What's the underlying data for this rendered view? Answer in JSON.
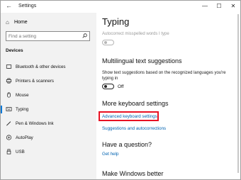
{
  "window": {
    "title": "Settings",
    "back_icon": "back-arrow-icon",
    "minimize_glyph": "—",
    "maximize_glyph": "☐",
    "close_glyph": "✕"
  },
  "sidebar": {
    "home_label": "Home",
    "search_placeholder": "Find a setting",
    "section_heading": "Devices",
    "items": [
      {
        "label": "Bluetooth & other devices",
        "icon": "bluetooth-icon"
      },
      {
        "label": "Printers & scanners",
        "icon": "printer-icon"
      },
      {
        "label": "Mouse",
        "icon": "mouse-icon"
      },
      {
        "label": "Typing",
        "icon": "keyboard-icon",
        "selected": true
      },
      {
        "label": "Pen & Windows Ink",
        "icon": "pen-icon"
      },
      {
        "label": "AutoPlay",
        "icon": "autoplay-icon"
      },
      {
        "label": "USB",
        "icon": "usb-icon"
      }
    ]
  },
  "main": {
    "title": "Typing",
    "autocorrect_label": "Autocorrect misspelled words I type",
    "multilingual": {
      "heading": "Multilingual text suggestions",
      "description": "Show text suggestions based on the recognized languages you're typing in",
      "toggle_state": "Off"
    },
    "more_keyboard": {
      "heading": "More keyboard settings",
      "advanced_link": "Advanced keyboard settings",
      "suggestions_link": "Suggestions and autocorrections"
    },
    "question": {
      "heading": "Have a question?",
      "help_link": "Get help"
    },
    "make_better": {
      "heading": "Make Windows better"
    }
  },
  "colors": {
    "accent": "#0078d7",
    "link": "#0063b1",
    "highlight": "#e81123"
  }
}
